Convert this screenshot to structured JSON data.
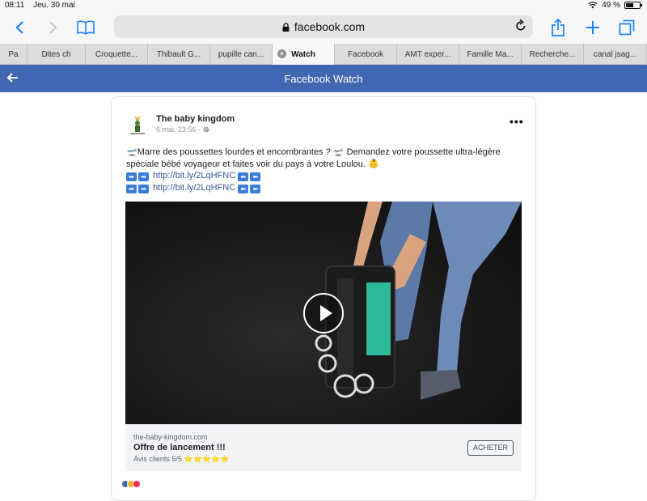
{
  "statusbar": {
    "time": "08:11",
    "date": "Jeu. 30 mai",
    "battery": "49 %",
    "battery_level": 0.49
  },
  "browser": {
    "url": "facebook.com"
  },
  "tabs": [
    {
      "label": "Pa",
      "width": 34
    },
    {
      "label": "Dites ch",
      "width": 72
    },
    {
      "label": "Croquette...",
      "width": 77
    },
    {
      "label": "Thibault G...",
      "width": 77
    },
    {
      "label": "pupille can...",
      "width": 77
    },
    {
      "label": "Watch",
      "width": 77,
      "active": true
    },
    {
      "label": "Facebook",
      "width": 77
    },
    {
      "label": "AMT exper...",
      "width": 77
    },
    {
      "label": "Famille Ma...",
      "width": 77
    },
    {
      "label": "Recherche...",
      "width": 77
    },
    {
      "label": "canal jsag...",
      "width": 78
    }
  ],
  "header": {
    "title": "Facebook Watch"
  },
  "post": {
    "author": "The baby kingdom",
    "date": "6 mai, 23:56 ·",
    "text_line1": "Marre des poussettes lourdes et encombrantes ? ",
    "text_line1b": " Demandez votre poussette ultra-légère",
    "text_line2": "spéciale bébé voyageur et faites voir du pays à votre Loulou. ",
    "link1": "http://bit.ly/2LqHFNC",
    "link2": "http://bit.ly/2LqHFNC"
  },
  "attachment": {
    "domain": "the-baby-kingdom.com",
    "headline": "Offre de lancement !!!",
    "desc": "Avis clients 5/5 ⭐⭐⭐⭐⭐",
    "cta": "ACHETER"
  },
  "colors": {
    "fb_blue": "#4267b2",
    "ios_blue": "#1a82fb",
    "link": "#385898"
  }
}
